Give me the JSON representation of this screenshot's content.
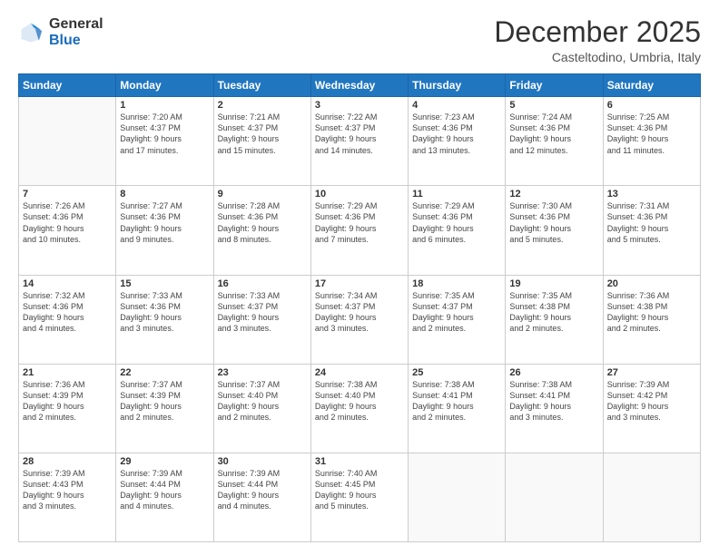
{
  "logo": {
    "general": "General",
    "blue": "Blue"
  },
  "header": {
    "month": "December 2025",
    "location": "Casteltodino, Umbria, Italy"
  },
  "weekdays": [
    "Sunday",
    "Monday",
    "Tuesday",
    "Wednesday",
    "Thursday",
    "Friday",
    "Saturday"
  ],
  "weeks": [
    [
      {
        "day": "",
        "info": ""
      },
      {
        "day": "1",
        "info": "Sunrise: 7:20 AM\nSunset: 4:37 PM\nDaylight: 9 hours\nand 17 minutes."
      },
      {
        "day": "2",
        "info": "Sunrise: 7:21 AM\nSunset: 4:37 PM\nDaylight: 9 hours\nand 15 minutes."
      },
      {
        "day": "3",
        "info": "Sunrise: 7:22 AM\nSunset: 4:37 PM\nDaylight: 9 hours\nand 14 minutes."
      },
      {
        "day": "4",
        "info": "Sunrise: 7:23 AM\nSunset: 4:36 PM\nDaylight: 9 hours\nand 13 minutes."
      },
      {
        "day": "5",
        "info": "Sunrise: 7:24 AM\nSunset: 4:36 PM\nDaylight: 9 hours\nand 12 minutes."
      },
      {
        "day": "6",
        "info": "Sunrise: 7:25 AM\nSunset: 4:36 PM\nDaylight: 9 hours\nand 11 minutes."
      }
    ],
    [
      {
        "day": "7",
        "info": "Sunrise: 7:26 AM\nSunset: 4:36 PM\nDaylight: 9 hours\nand 10 minutes."
      },
      {
        "day": "8",
        "info": "Sunrise: 7:27 AM\nSunset: 4:36 PM\nDaylight: 9 hours\nand 9 minutes."
      },
      {
        "day": "9",
        "info": "Sunrise: 7:28 AM\nSunset: 4:36 PM\nDaylight: 9 hours\nand 8 minutes."
      },
      {
        "day": "10",
        "info": "Sunrise: 7:29 AM\nSunset: 4:36 PM\nDaylight: 9 hours\nand 7 minutes."
      },
      {
        "day": "11",
        "info": "Sunrise: 7:29 AM\nSunset: 4:36 PM\nDaylight: 9 hours\nand 6 minutes."
      },
      {
        "day": "12",
        "info": "Sunrise: 7:30 AM\nSunset: 4:36 PM\nDaylight: 9 hours\nand 5 minutes."
      },
      {
        "day": "13",
        "info": "Sunrise: 7:31 AM\nSunset: 4:36 PM\nDaylight: 9 hours\nand 5 minutes."
      }
    ],
    [
      {
        "day": "14",
        "info": "Sunrise: 7:32 AM\nSunset: 4:36 PM\nDaylight: 9 hours\nand 4 minutes."
      },
      {
        "day": "15",
        "info": "Sunrise: 7:33 AM\nSunset: 4:36 PM\nDaylight: 9 hours\nand 3 minutes."
      },
      {
        "day": "16",
        "info": "Sunrise: 7:33 AM\nSunset: 4:37 PM\nDaylight: 9 hours\nand 3 minutes."
      },
      {
        "day": "17",
        "info": "Sunrise: 7:34 AM\nSunset: 4:37 PM\nDaylight: 9 hours\nand 3 minutes."
      },
      {
        "day": "18",
        "info": "Sunrise: 7:35 AM\nSunset: 4:37 PM\nDaylight: 9 hours\nand 2 minutes."
      },
      {
        "day": "19",
        "info": "Sunrise: 7:35 AM\nSunset: 4:38 PM\nDaylight: 9 hours\nand 2 minutes."
      },
      {
        "day": "20",
        "info": "Sunrise: 7:36 AM\nSunset: 4:38 PM\nDaylight: 9 hours\nand 2 minutes."
      }
    ],
    [
      {
        "day": "21",
        "info": "Sunrise: 7:36 AM\nSunset: 4:39 PM\nDaylight: 9 hours\nand 2 minutes."
      },
      {
        "day": "22",
        "info": "Sunrise: 7:37 AM\nSunset: 4:39 PM\nDaylight: 9 hours\nand 2 minutes."
      },
      {
        "day": "23",
        "info": "Sunrise: 7:37 AM\nSunset: 4:40 PM\nDaylight: 9 hours\nand 2 minutes."
      },
      {
        "day": "24",
        "info": "Sunrise: 7:38 AM\nSunset: 4:40 PM\nDaylight: 9 hours\nand 2 minutes."
      },
      {
        "day": "25",
        "info": "Sunrise: 7:38 AM\nSunset: 4:41 PM\nDaylight: 9 hours\nand 2 minutes."
      },
      {
        "day": "26",
        "info": "Sunrise: 7:38 AM\nSunset: 4:41 PM\nDaylight: 9 hours\nand 3 minutes."
      },
      {
        "day": "27",
        "info": "Sunrise: 7:39 AM\nSunset: 4:42 PM\nDaylight: 9 hours\nand 3 minutes."
      }
    ],
    [
      {
        "day": "28",
        "info": "Sunrise: 7:39 AM\nSunset: 4:43 PM\nDaylight: 9 hours\nand 3 minutes."
      },
      {
        "day": "29",
        "info": "Sunrise: 7:39 AM\nSunset: 4:44 PM\nDaylight: 9 hours\nand 4 minutes."
      },
      {
        "day": "30",
        "info": "Sunrise: 7:39 AM\nSunset: 4:44 PM\nDaylight: 9 hours\nand 4 minutes."
      },
      {
        "day": "31",
        "info": "Sunrise: 7:40 AM\nSunset: 4:45 PM\nDaylight: 9 hours\nand 5 minutes."
      },
      {
        "day": "",
        "info": ""
      },
      {
        "day": "",
        "info": ""
      },
      {
        "day": "",
        "info": ""
      }
    ]
  ]
}
